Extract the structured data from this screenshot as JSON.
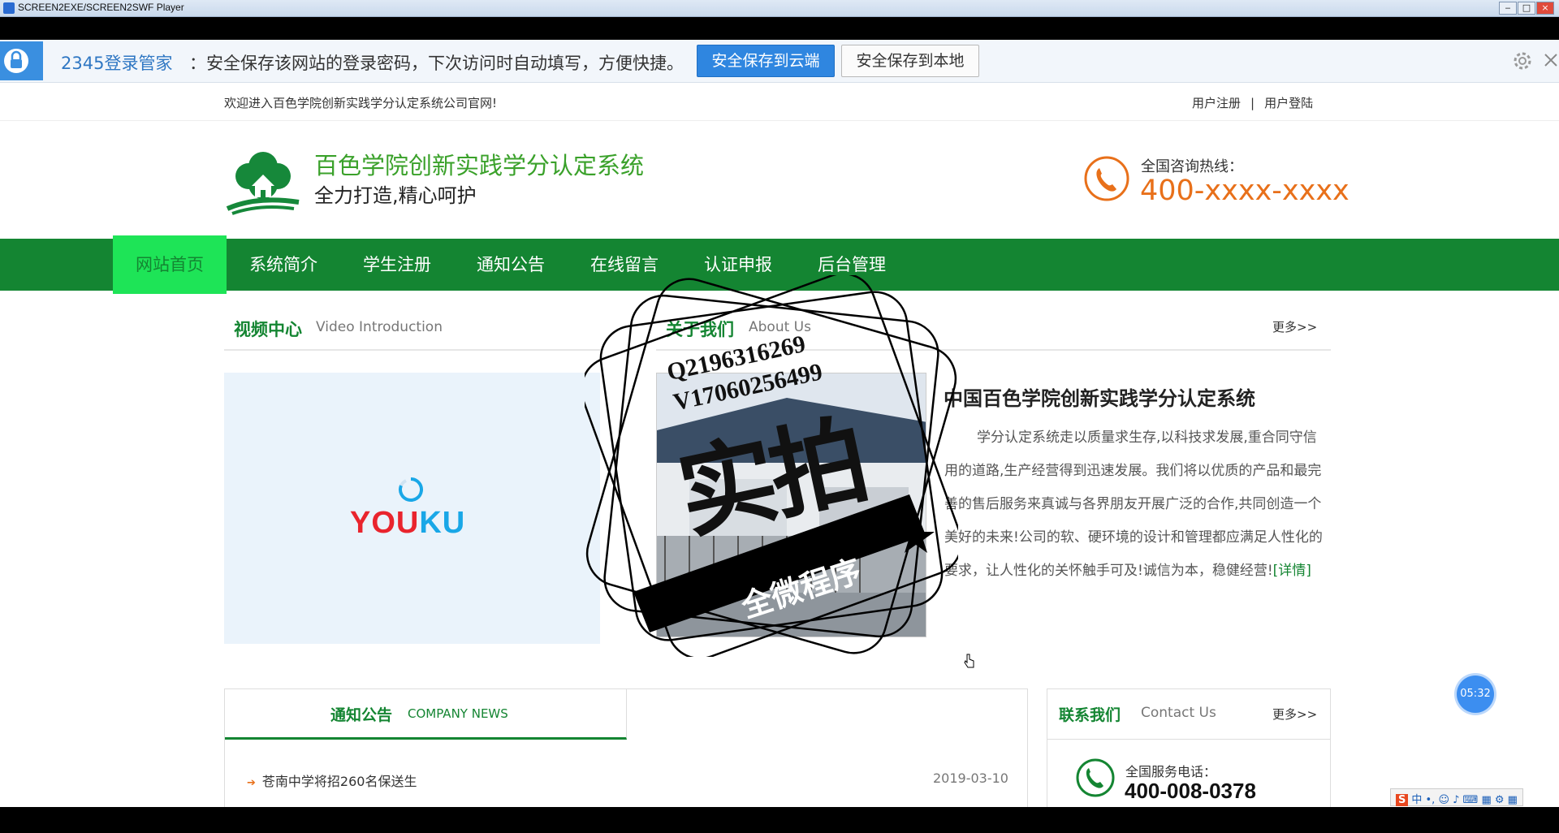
{
  "window": {
    "title": "SCREEN2EXE/SCREEN2SWF Player",
    "min_label": "‒",
    "max_label": "□",
    "close_label": "×"
  },
  "password_bar": {
    "brand": "2345登录管家",
    "message": "：安全保存该网站的登录密码，下次访问时自动填写，方便快捷。",
    "cloud_button": "安全保存到云端",
    "local_button": "安全保存到本地"
  },
  "site": {
    "welcome": "欢迎进入百色学院创新实践学分认定系统公司官网!",
    "register_link": "用户注册",
    "separator": "|",
    "login_link": "用户登陆",
    "title": "百色学院创新实践学分认定系统",
    "subtitle": "全力打造,精心呵护",
    "hotline_label": "全国咨询热线：",
    "hotline_number": "400-xxxx-xxxx"
  },
  "nav": {
    "items": [
      {
        "label": "网站首页"
      },
      {
        "label": "系统简介"
      },
      {
        "label": "学生注册"
      },
      {
        "label": "通知公告"
      },
      {
        "label": "在线留言"
      },
      {
        "label": "认证申报"
      },
      {
        "label": "后台管理"
      }
    ]
  },
  "video_section": {
    "title": "视频中心",
    "title_en": "Video Introduction",
    "player_logo_left": "YOU",
    "player_logo_right": "KU"
  },
  "about_section": {
    "title": "关于我们",
    "title_en": "About Us",
    "more": "更多>>",
    "headline": "中国百色学院创新实践学分认定系统",
    "paragraph": "学分认定系统走以质量求生存,以科技求发展,重合同守信用的道路,生产经营得到迅速发展。我们将以优质的产品和最完善的售后服务来真诚与各界朋友开展广泛的合作,共同创造一个美好的未来!公司的软、硬环境的设计和管理都应满足人性化的要求，让人性化的关怀触手可及!诚信为本，稳健经营!",
    "detail_link": "[详情]"
  },
  "news_section": {
    "title": "通知公告",
    "title_en": "COMPANY NEWS",
    "items": [
      {
        "title": "苍南中学将招260名保送生",
        "date": "2019-03-10"
      }
    ]
  },
  "contact_section": {
    "title": "联系我们",
    "title_en": "Contact Us",
    "more": "更多>>",
    "service_label": "全国服务电话：",
    "service_number": "400-008-0378"
  },
  "watermark": {
    "line1": "Q2196316269",
    "line2": "V17060256499",
    "big_text": "实拍",
    "banner": "全微程序"
  },
  "overlay": {
    "timer": "05:32",
    "ime_logo": "S",
    "ime_mode": "中 •, ☺ ♪ ⌨ ▦ ⚙ ▦"
  },
  "colors": {
    "brand_green": "#148532",
    "active_green": "#1ee457",
    "accent_orange": "#e8701a",
    "bar_blue": "#2f86e0"
  }
}
